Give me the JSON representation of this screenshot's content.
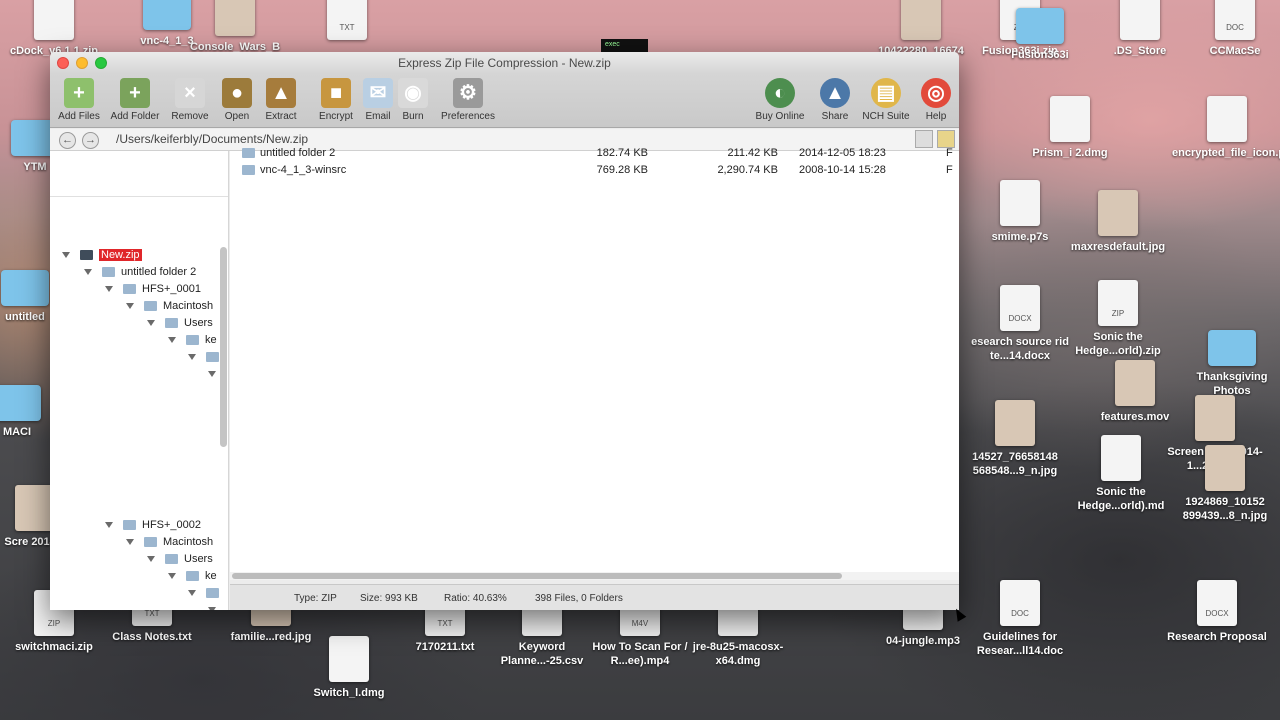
{
  "window": {
    "title": "Express Zip File Compression - New.zip"
  },
  "toolbar": {
    "left": [
      {
        "label": "Add Files",
        "icon": "add-files-icon",
        "color": "#8ec06c",
        "glyph": "+"
      },
      {
        "label": "Add Folder",
        "icon": "add-folder-icon",
        "color": "#7ba35c",
        "glyph": "+"
      },
      {
        "label": "Remove",
        "icon": "remove-icon",
        "color": "#d6d6d6",
        "glyph": "×"
      },
      {
        "label": "Open",
        "icon": "open-icon",
        "color": "#9c7b3b",
        "glyph": "●"
      },
      {
        "label": "Extract",
        "icon": "extract-icon",
        "color": "#a67c3c",
        "glyph": "▲"
      },
      {
        "label": "Encrypt",
        "icon": "encrypt-icon",
        "color": "#c7963f",
        "glyph": "■"
      },
      {
        "label": "Email",
        "icon": "email-icon",
        "color": "#b9cfe3",
        "glyph": "✉"
      },
      {
        "label": "Burn",
        "icon": "burn-icon",
        "color": "#d9d9d9",
        "glyph": "◉"
      },
      {
        "label": "Preferences",
        "icon": "preferences-icon",
        "color": "#9a9a9a",
        "glyph": "⚙"
      }
    ],
    "right": [
      {
        "label": "Buy Online",
        "icon": "buy-online-icon",
        "color": "#4d8e4f",
        "glyph": "◐"
      },
      {
        "label": "Share",
        "icon": "share-icon",
        "color": "#4c78a8",
        "glyph": "▲"
      },
      {
        "label": "NCH Suite",
        "icon": "nch-suite-icon",
        "color": "#e0b64a",
        "glyph": "▤"
      },
      {
        "label": "Help",
        "icon": "help-icon",
        "color": "#e24a3b",
        "glyph": "◎"
      }
    ]
  },
  "path": {
    "value": "/Users/keiferbly/Documents/New.zip",
    "back_glyph": "←",
    "forward_glyph": "→"
  },
  "tree": [
    {
      "label": "New.zip",
      "selected": true
    },
    {
      "label": "untitled folder 2"
    },
    {
      "label": "HFS+_0001"
    },
    {
      "label": "Macintosh"
    },
    {
      "label": "Users"
    },
    {
      "label": "ke"
    },
    {
      "label": ""
    },
    {
      "label": ""
    },
    {
      "label": "HFS+_0002"
    },
    {
      "label": "Macintosh"
    },
    {
      "label": "Users"
    },
    {
      "label": "ke"
    },
    {
      "label": ""
    },
    {
      "label": ""
    }
  ],
  "files": [
    {
      "name": "untitled folder 2",
      "size": "182.74 KB",
      "packed": "211.42 KB",
      "date": "2014-12-05 18:23",
      "flag": "F"
    },
    {
      "name": "vnc-4_1_3-winsrc",
      "size": "769.28 KB",
      "packed": "2,290.74 KB",
      "date": "2008-10-14 15:28",
      "flag": "F"
    }
  ],
  "status": {
    "type": "Type: ZIP",
    "size": "Size: 993 KB",
    "ratio": "Ratio: 40.63%",
    "count": "398 Files, 0 Folders"
  },
  "desktop": {
    "exec_label": "exec",
    "icons": [
      {
        "label": "cDock_v6.1.1.zip",
        "kind": "file",
        "tag": ""
      },
      {
        "label": "vnc-4_1_3",
        "kind": "folder",
        "tag": ""
      },
      {
        "label": "Console_Wars_B",
        "kind": "img",
        "tag": ""
      },
      {
        "label": "",
        "kind": "file",
        "tag": "TXT"
      },
      {
        "label": "10422280_16674",
        "kind": "img",
        "tag": ""
      },
      {
        "label": "Fusion363i.zip",
        "kind": "file",
        "tag": "ZIP"
      },
      {
        "label": "Fusion363i",
        "kind": "folder",
        "tag": ""
      },
      {
        "label": ".DS_Store",
        "kind": "file",
        "tag": ""
      },
      {
        "label": "CCMacSe",
        "kind": "file",
        "tag": "DOC"
      },
      {
        "label": "YTM",
        "kind": "folder",
        "tag": ""
      },
      {
        "label": "Prism_i 2.dmg",
        "kind": "file",
        "tag": ""
      },
      {
        "label": "encrypted_file_icon.png",
        "kind": "file",
        "tag": ""
      },
      {
        "label": "smime.p7s",
        "kind": "file",
        "tag": ""
      },
      {
        "label": "maxresdefault.jpg",
        "kind": "img",
        "tag": ""
      },
      {
        "label": "untitled",
        "kind": "folder",
        "tag": ""
      },
      {
        "label": "esearch source rid te...14.docx",
        "kind": "file",
        "tag": "DOCX"
      },
      {
        "label": "Sonic the Hedge...orld).zip",
        "kind": "file",
        "tag": "ZIP"
      },
      {
        "label": "features.mov",
        "kind": "img",
        "tag": ""
      },
      {
        "label": "Thanksgiving Photos",
        "kind": "folder",
        "tag": ""
      },
      {
        "label": "MACI",
        "kind": "folder",
        "tag": ""
      },
      {
        "label": "14527_76658148 568548...9_n.jpg",
        "kind": "img",
        "tag": ""
      },
      {
        "label": "Screen Shot 2014-1...2.28 PM",
        "kind": "img",
        "tag": ""
      },
      {
        "label": "Sonic the Hedge...orld).md",
        "kind": "file",
        "tag": ""
      },
      {
        "label": "1924869_10152 899439...8_n.jpg",
        "kind": "img",
        "tag": ""
      },
      {
        "label": "Scre 2014-1",
        "kind": "img",
        "tag": ""
      },
      {
        "label": "switchmaci.zip",
        "kind": "file",
        "tag": "ZIP"
      },
      {
        "label": "Class Notes.txt",
        "kind": "file",
        "tag": "TXT"
      },
      {
        "label": "familie...red.jpg",
        "kind": "img",
        "tag": ""
      },
      {
        "label": "Switch_l.dmg",
        "kind": "file",
        "tag": ""
      },
      {
        "label": "7170211.txt",
        "kind": "file",
        "tag": "TXT"
      },
      {
        "label": "Keyword Planne...-25.csv",
        "kind": "file",
        "tag": ""
      },
      {
        "label": "How To Scan For / R...ee).mp4",
        "kind": "file",
        "tag": "M4V"
      },
      {
        "label": "jre-8u25-macosx-x64.dmg",
        "kind": "file",
        "tag": ""
      },
      {
        "label": "04-jungle.mp3",
        "kind": "file",
        "tag": ""
      },
      {
        "label": "Guidelines for Resear...ll14.doc",
        "kind": "file",
        "tag": "DOC"
      },
      {
        "label": "Research Proposal",
        "kind": "file",
        "tag": "DOCX"
      }
    ]
  }
}
